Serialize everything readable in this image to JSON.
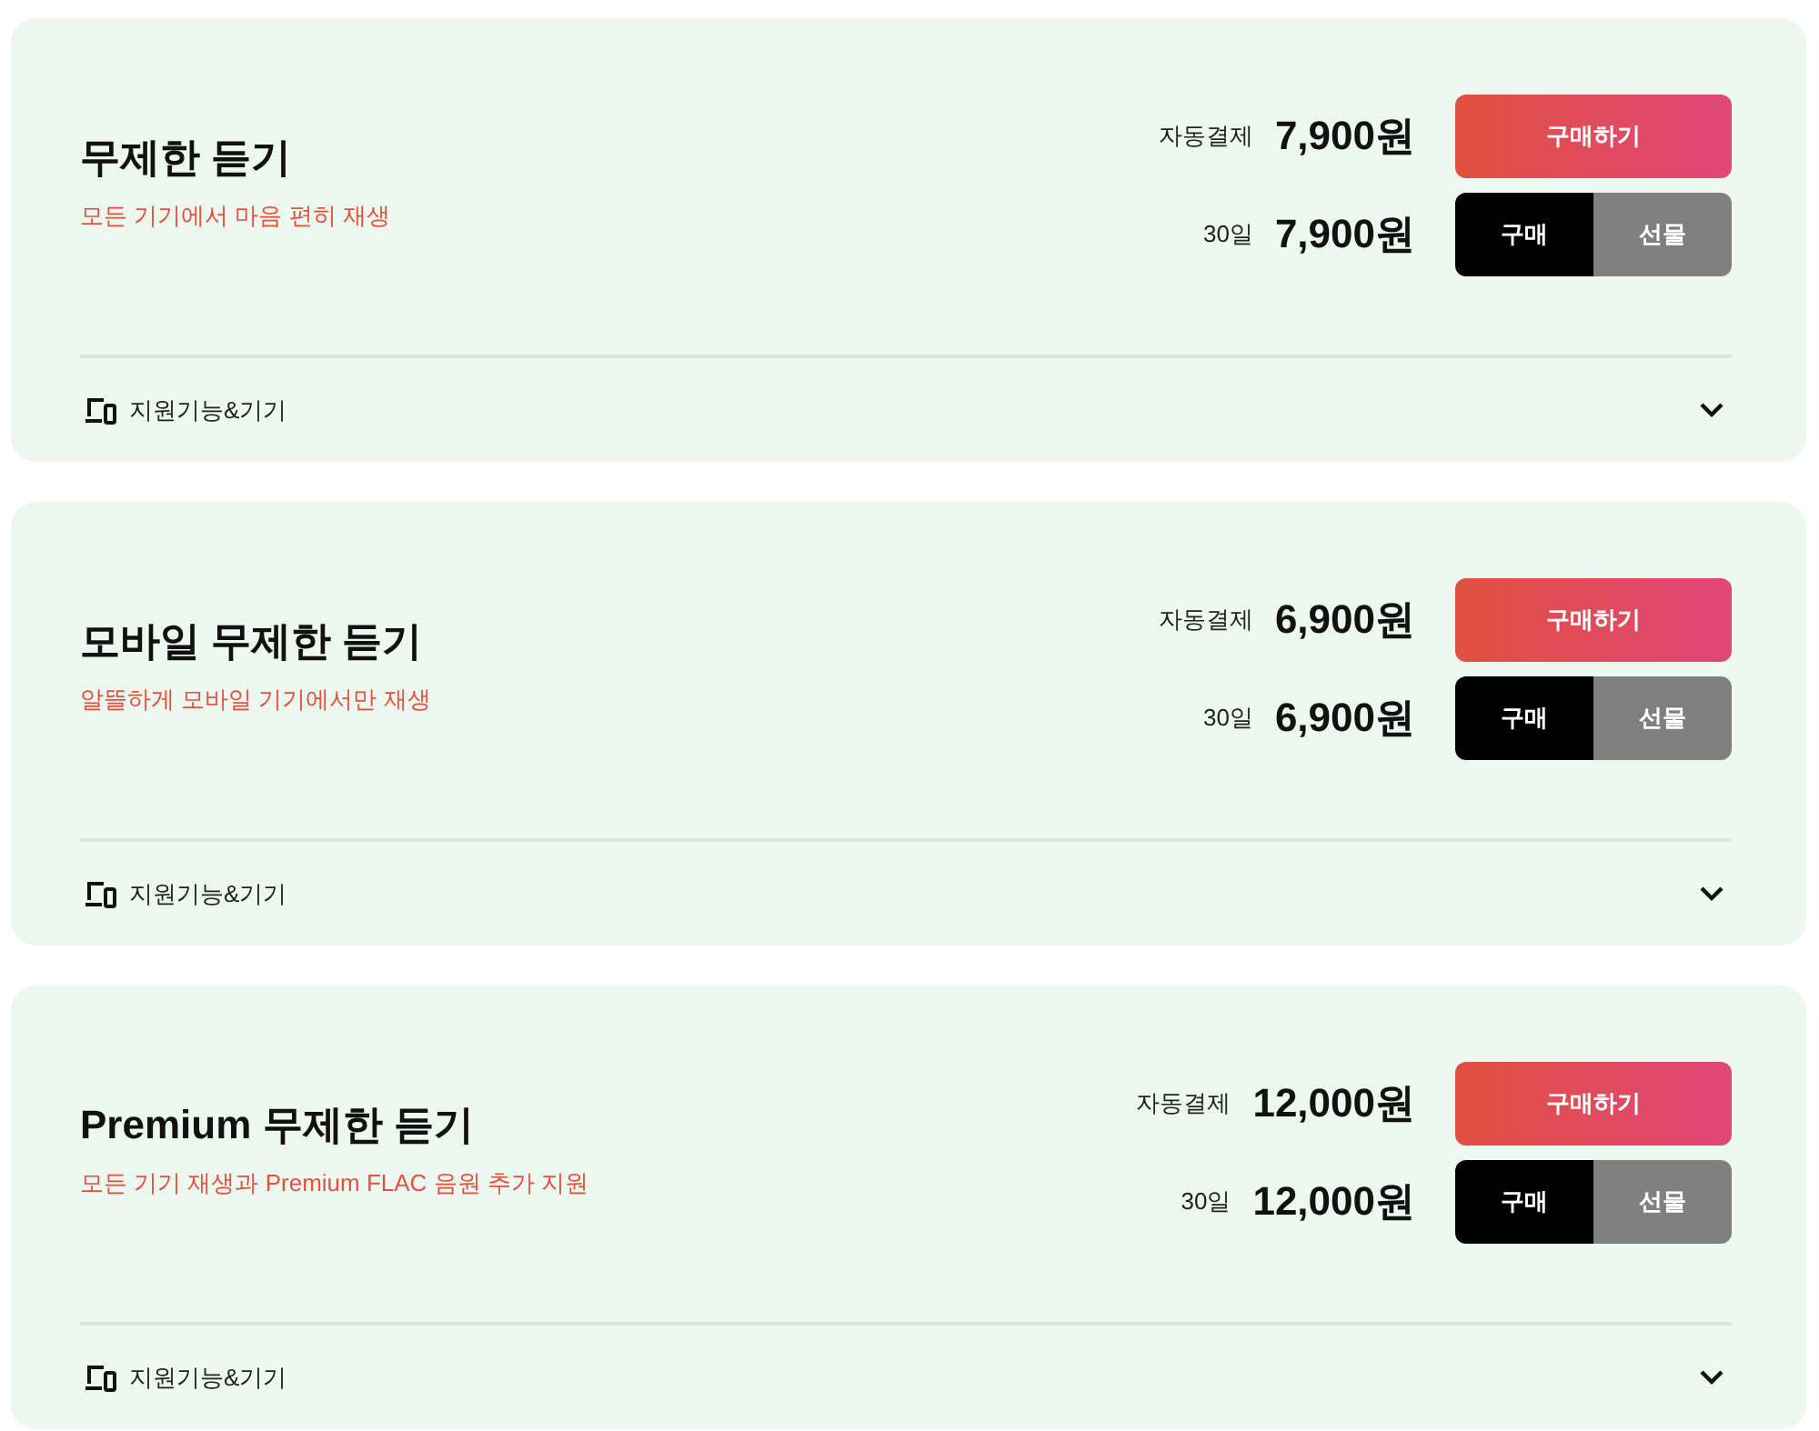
{
  "plans": [
    {
      "title": "무제한 듣기",
      "subtitle": "모든 기기에서 마음 편히 재생",
      "prices": [
        {
          "label": "자동결제",
          "price": "7,900원",
          "buttons": [
            {
              "kind": "primary",
              "label": "구매하기"
            }
          ]
        },
        {
          "label": "30일",
          "price": "7,900원",
          "buttons": [
            {
              "kind": "dark",
              "label": "구매"
            },
            {
              "kind": "grey",
              "label": "선물"
            }
          ]
        }
      ],
      "footer": {
        "label": "지원기능&기기",
        "expanded": false
      }
    },
    {
      "title": "모바일 무제한 듣기",
      "subtitle": "알뜰하게 모바일 기기에서만 재생",
      "prices": [
        {
          "label": "자동결제",
          "price": "6,900원",
          "buttons": [
            {
              "kind": "primary",
              "label": "구매하기"
            }
          ]
        },
        {
          "label": "30일",
          "price": "6,900원",
          "buttons": [
            {
              "kind": "dark",
              "label": "구매"
            },
            {
              "kind": "grey",
              "label": "선물"
            }
          ]
        }
      ],
      "footer": {
        "label": "지원기능&기기",
        "expanded": false
      }
    },
    {
      "title": "Premium 무제한 듣기",
      "subtitle": "모든 기기 재생과 Premium FLAC 음원 추가 지원",
      "prices": [
        {
          "label": "자동결제",
          "price": "12,000원",
          "buttons": [
            {
              "kind": "primary",
              "label": "구매하기"
            }
          ]
        },
        {
          "label": "30일",
          "price": "12,000원",
          "buttons": [
            {
              "kind": "dark",
              "label": "구매"
            },
            {
              "kind": "grey",
              "label": "선물"
            }
          ]
        }
      ],
      "footer": {
        "label": "지원기능&기기",
        "expanded": false
      }
    }
  ]
}
